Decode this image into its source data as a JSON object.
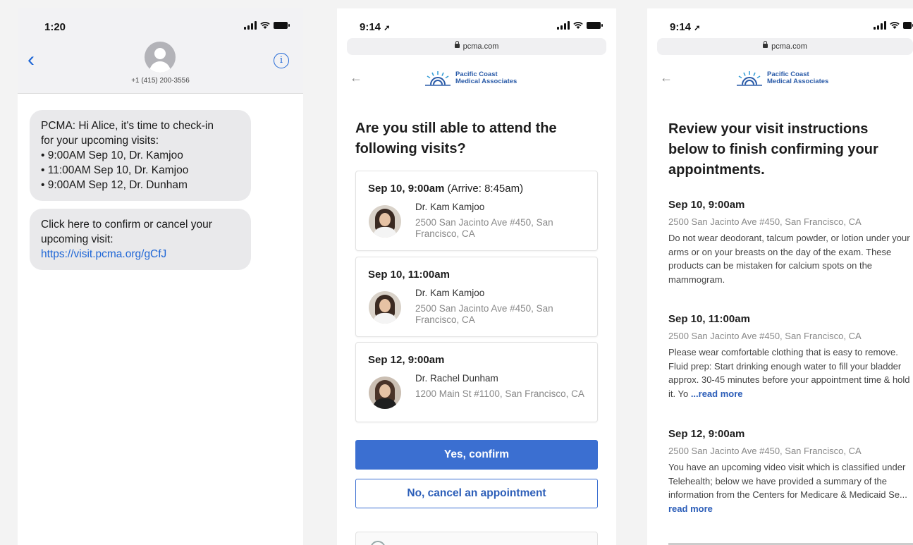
{
  "colors": {
    "accent": "#3b6fd1",
    "link": "#1e66d6",
    "bubble": "#e9e9eb"
  },
  "sms": {
    "time": "1:20",
    "contact_number": "+1 (415) 200-3556",
    "back_icon": "chevron-left-icon",
    "info_icon": "info-icon",
    "message_1": {
      "lines": [
        "PCMA: Hi Alice, it's time to check-in",
        "for your upcoming visits:",
        "• 9:00AM Sep 10, Dr. Kamjoo",
        "• 11:00AM Sep 10, Dr. Kamjoo",
        "• 9:00AM Sep 12, Dr. Dunham"
      ]
    },
    "message_2": {
      "lines": [
        "Click here to confirm or cancel your",
        "upcoming visit:"
      ],
      "link": "https://visit.pcma.org/gCfJ"
    }
  },
  "confirm": {
    "time": "9:14",
    "url": "pcma.com",
    "logo": {
      "line1": "Pacific Coast",
      "line2": "Medical Associates"
    },
    "heading": "Are you still able to attend the following visits?",
    "visits": [
      {
        "title": "Sep 10, 9:00am",
        "arrive": "(Arrive: 8:45am)",
        "doctor": "Dr. Kam Kamjoo",
        "address": "2500 San Jacinto Ave #450, San Francisco, CA"
      },
      {
        "title": "Sep 10, 11:00am",
        "arrive": "",
        "doctor": "Dr. Kam Kamjoo",
        "address": "2500 San Jacinto Ave #450, San Francisco, CA"
      },
      {
        "title": "Sep 12, 9:00am",
        "arrive": "",
        "doctor": "Dr. Rachel Dunham",
        "address": "1200 Main St #1100, San Francisco, CA"
      }
    ],
    "confirm_label": "Yes, confirm",
    "cancel_label": "No, cancel an appointment"
  },
  "review": {
    "time": "9:14",
    "url": "pcma.com",
    "logo": {
      "line1": "Pacific Coast",
      "line2": "Medical Associates"
    },
    "heading": "Review your visit instructions below to finish confirming your appointments.",
    "read_more_label": "...read more",
    "visits": [
      {
        "time": "Sep 10, 9:00am",
        "address": "2500 San Jacinto Ave #450, San Francisco, CA",
        "note": "Do not wear deodorant, talcum powder, or lotion under your arms or on your breasts on the day of the exam. These products can be mistaken for calcium spots on the mammogram.",
        "read_more": ""
      },
      {
        "time": "Sep 10, 11:00am",
        "address": "2500 San Jacinto Ave #450, San Francisco, CA",
        "note": "Please wear comfortable clothing that is easy to remove.  Fluid prep: Start drinking enough water to fill your bladder approx. 30-45 minutes before your appointment time & hold it.  Yo ",
        "read_more": "...read more"
      },
      {
        "time": "Sep 12, 9:00am",
        "address": "2500 San Jacinto Ave #450, San Francisco, CA",
        "note": "You have an upcoming video visit which is classified under Telehealth; below we have provided a summary of the information from the Centers for Medicare & Medicaid Se... ",
        "read_more": "read more"
      }
    ]
  }
}
